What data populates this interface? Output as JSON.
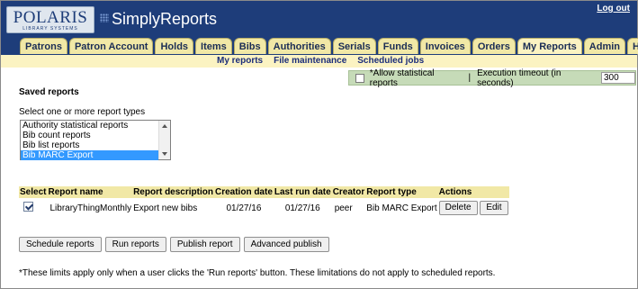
{
  "header": {
    "logo_brand": "POLARIS",
    "logo_tag": "LIBRARY SYSTEMS",
    "app_title": "SimplyReports",
    "logout_label": "Log out"
  },
  "tabs": [
    "Patrons",
    "Patron Account",
    "Holds",
    "Items",
    "Bibs",
    "Authorities",
    "Serials",
    "Funds",
    "Invoices",
    "Orders",
    "My Reports",
    "Admin",
    "Help"
  ],
  "active_tab": "My Reports",
  "subnav": [
    "My reports",
    "File maintenance",
    "Scheduled jobs"
  ],
  "options": {
    "allow_stat_label": "*Allow statistical reports",
    "separator": "|",
    "timeout_label": "Execution timeout (in seconds)",
    "timeout_value": "300"
  },
  "saved_reports_title": "Saved reports",
  "report_types_hint": "Select one or more report types",
  "report_types": [
    {
      "label": "Authority statistical reports",
      "selected": false
    },
    {
      "label": "Bib count reports",
      "selected": false
    },
    {
      "label": "Bib list reports",
      "selected": false
    },
    {
      "label": "Bib MARC Export",
      "selected": true
    }
  ],
  "table": {
    "headers": [
      "Select",
      "Report name",
      "Report description",
      "Creation date",
      "Last run date",
      "Creator",
      "Report type",
      "Actions"
    ],
    "rows": [
      {
        "report_name": "LibraryThingMonthly",
        "description": "Export new bibs",
        "created": "01/27/16",
        "last_run": "01/27/16",
        "creator": "peer",
        "type": "Bib MARC Export",
        "delete_label": "Delete",
        "edit_label": "Edit"
      }
    ]
  },
  "actions": {
    "schedule": "Schedule reports",
    "run": "Run reports",
    "publish": "Publish report",
    "advanced": "Advanced publish"
  },
  "footnote": "*These limits apply only when a user clicks the 'Run reports' button. These limitations do not apply to scheduled reports."
}
